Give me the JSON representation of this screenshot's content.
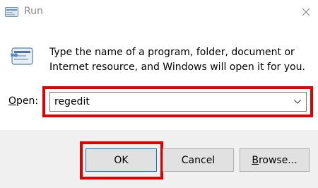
{
  "window": {
    "title": "Run",
    "title_icon": "run-icon",
    "close_icon": "close-icon"
  },
  "body": {
    "icon": "run-program-icon",
    "description": "Type the name of a program, folder, document or Internet resource, and Windows will open it for you.",
    "open_label_underlined": "O",
    "open_label_rest": "pen:",
    "open_value": "regedit"
  },
  "buttons": {
    "ok": "OK",
    "cancel": "Cancel",
    "browse_underlined": "B",
    "browse_rest": "rowse..."
  },
  "colors": {
    "highlight": "#e00000",
    "footer_bg": "#f0f0f0",
    "button_bg": "#e1e1e1",
    "default_button_border": "#0078d7"
  }
}
